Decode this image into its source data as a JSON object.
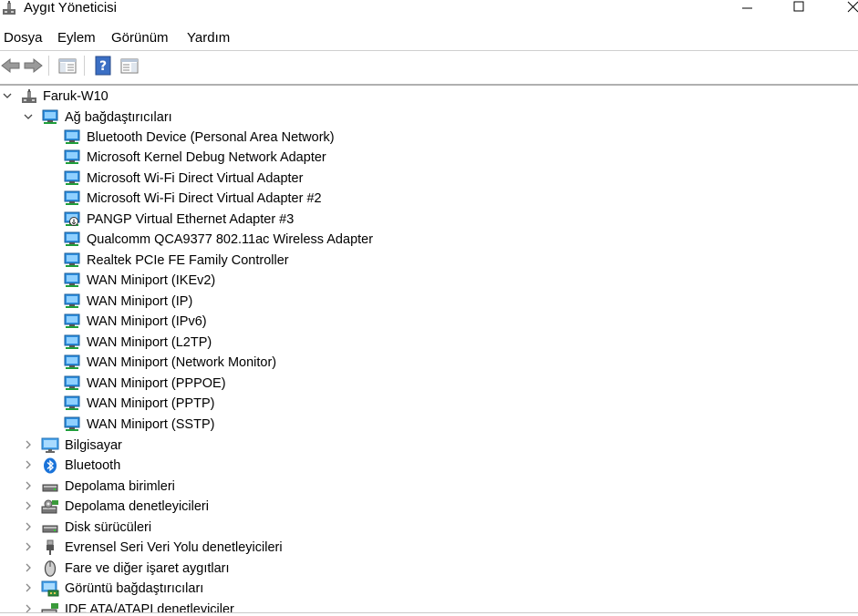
{
  "window": {
    "title": "Aygıt Yöneticisi"
  },
  "menu": [
    "Dosya",
    "Eylem",
    "Görünüm",
    "Yardım"
  ],
  "toolbar": [
    "back-arrow-icon",
    "forward-arrow-icon",
    "show-hide-console-tree-icon",
    "help-icon",
    "properties-icon"
  ],
  "tree": {
    "root": "Faruk-W10",
    "expanded_category": "Ağ bağdaştırıcıları",
    "adapters": [
      "Bluetooth Device (Personal Area Network)",
      "Microsoft Kernel Debug Network Adapter",
      "Microsoft Wi-Fi Direct Virtual Adapter",
      "Microsoft Wi-Fi Direct Virtual Adapter #2",
      "PANGP Virtual Ethernet Adapter #3",
      "Qualcomm QCA9377 802.11ac Wireless Adapter",
      "Realtek PCIe FE Family Controller",
      "WAN Miniport (IKEv2)",
      "WAN Miniport (IP)",
      "WAN Miniport (IPv6)",
      "WAN Miniport (L2TP)",
      "WAN Miniport (Network Monitor)",
      "WAN Miniport (PPPOE)",
      "WAN Miniport (PPTP)",
      "WAN Miniport (SSTP)"
    ],
    "categories": [
      "Bilgisayar",
      "Bluetooth",
      "Depolama birimleri",
      "Depolama denetleyicileri",
      "Disk sürücüleri",
      "Evrensel Seri Veri Yolu denetleyicileri",
      "Fare ve diğer işaret aygıtları",
      "Görüntü bağdaştırıcıları",
      "IDE ATA/ATAPI denetleyiciler"
    ]
  }
}
